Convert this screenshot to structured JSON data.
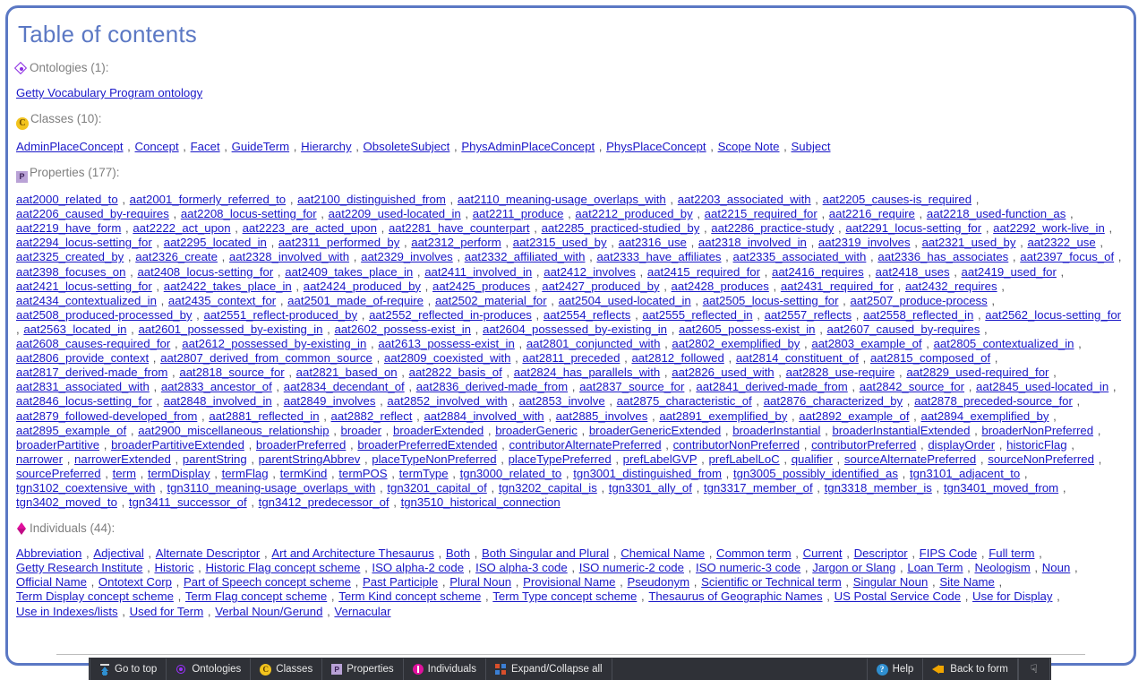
{
  "page": {
    "title": "Table of contents",
    "accent_color": "#5b78c4",
    "link_color": "#1a18c8",
    "section_label_color": "#7f7f7f"
  },
  "sections": [
    {
      "id": "ontologies",
      "icon": "ontology-diamond-icon",
      "label": "Ontologies (1):",
      "count": 1,
      "items": [
        "Getty Vocabulary Program ontology"
      ]
    },
    {
      "id": "classes",
      "icon": "class-circle-c-icon",
      "label": "Classes (10):",
      "count": 10,
      "items": [
        "AdminPlaceConcept",
        "Concept",
        "Facet",
        "GuideTerm",
        "Hierarchy",
        "ObsoleteSubject",
        "PhysAdminPlaceConcept",
        "PhysPlaceConcept",
        "Scope Note",
        "Subject"
      ]
    },
    {
      "id": "properties",
      "icon": "property-square-p-icon",
      "label": "Properties (177):",
      "count": 177,
      "items": [
        "aat2000_related_to",
        "aat2001_formerly_referred_to",
        "aat2100_distinguished_from",
        "aat2110_meaning-usage_overlaps_with",
        "aat2203_associated_with",
        "aat2205_causes-is_required",
        "aat2206_caused_by-requires",
        "aat2208_locus-setting_for",
        "aat2209_used-located_in",
        "aat2211_produce",
        "aat2212_produced_by",
        "aat2215_required_for",
        "aat2216_require",
        "aat2218_used-function_as",
        "aat2219_have_form",
        "aat2222_act_upon",
        "aat2223_are_acted_upon",
        "aat2281_have_counterpart",
        "aat2285_practiced-studied_by",
        "aat2286_practice-study",
        "aat2291_locus-setting_for",
        "aat2292_work-live_in",
        "aat2294_locus-setting_for",
        "aat2295_located_in",
        "aat2311_performed_by",
        "aat2312_perform",
        "aat2315_used_by",
        "aat2316_use",
        "aat2318_involved_in",
        "aat2319_involves",
        "aat2321_used_by",
        "aat2322_use",
        "aat2325_created_by",
        "aat2326_create",
        "aat2328_involved_with",
        "aat2329_involves",
        "aat2332_affiliated_with",
        "aat2333_have_affiliates",
        "aat2335_associated_with",
        "aat2336_has_associates",
        "aat2397_focus_of",
        "aat2398_focuses_on",
        "aat2408_locus-setting_for",
        "aat2409_takes_place_in",
        "aat2411_involved_in",
        "aat2412_involves",
        "aat2415_required_for",
        "aat2416_requires",
        "aat2418_uses",
        "aat2419_used_for",
        "aat2421_locus-setting_for",
        "aat2422_takes_place_in",
        "aat2424_produced_by",
        "aat2425_produces",
        "aat2427_produced_by",
        "aat2428_produces",
        "aat2431_required_for",
        "aat2432_requires",
        "aat2434_contextualized_in",
        "aat2435_context_for",
        "aat2501_made_of-require",
        "aat2502_material_for",
        "aat2504_used-located_in",
        "aat2505_locus-setting_for",
        "aat2507_produce-process",
        "aat2508_produced-processed_by",
        "aat2551_reflect-produced_by",
        "aat2552_reflected_in-produces",
        "aat2554_reflects",
        "aat2555_reflected_in",
        "aat2557_reflects",
        "aat2558_reflected_in",
        "aat2562_locus-setting_for",
        "aat2563_located_in",
        "aat2601_possessed_by-existing_in",
        "aat2602_possess-exist_in",
        "aat2604_possessed_by-existing_in",
        "aat2605_possess-exist_in",
        "aat2607_caused_by-requires",
        "aat2608_causes-required_for",
        "aat2612_possessed_by-existing_in",
        "aat2613_possess-exist_in",
        "aat2801_conjuncted_with",
        "aat2802_exemplified_by",
        "aat2803_example_of",
        "aat2805_contextualized_in",
        "aat2806_provide_context",
        "aat2807_derived_from_common_source",
        "aat2809_coexisted_with",
        "aat2811_preceded",
        "aat2812_followed",
        "aat2814_constituent_of",
        "aat2815_composed_of",
        "aat2817_derived-made_from",
        "aat2818_source_for",
        "aat2821_based_on",
        "aat2822_basis_of",
        "aat2824_has_parallels_with",
        "aat2826_used_with",
        "aat2828_use-require",
        "aat2829_used-required_for",
        "aat2831_associated_with",
        "aat2833_ancestor_of",
        "aat2834_decendant_of",
        "aat2836_derived-made_from",
        "aat2837_source_for",
        "aat2841_derived-made_from",
        "aat2842_source_for",
        "aat2845_used-located_in",
        "aat2846_locus-setting_for",
        "aat2848_involved_in",
        "aat2849_involves",
        "aat2852_involved_with",
        "aat2853_involve",
        "aat2875_characteristic_of",
        "aat2876_characterized_by",
        "aat2878_preceded-source_for",
        "aat2879_followed-developed_from",
        "aat2881_reflected_in",
        "aat2882_reflect",
        "aat2884_involved_with",
        "aat2885_involves",
        "aat2891_exemplified_by",
        "aat2892_example_of",
        "aat2894_exemplified_by",
        "aat2895_example_of",
        "aat2900_miscellaneous_relationship",
        "broader",
        "broaderExtended",
        "broaderGeneric",
        "broaderGenericExtended",
        "broaderInstantial",
        "broaderInstantialExtended",
        "broaderNonPreferred",
        "broaderPartitive",
        "broaderPartitiveExtended",
        "broaderPreferred",
        "broaderPreferredExtended",
        "contributorAlternatePreferred",
        "contributorNonPreferred",
        "contributorPreferred",
        "displayOrder",
        "historicFlag",
        "narrower",
        "narrowerExtended",
        "parentString",
        "parentStringAbbrev",
        "placeTypeNonPreferred",
        "placeTypePreferred",
        "prefLabelGVP",
        "prefLabelLoC",
        "qualifier",
        "sourceAlternatePreferred",
        "sourceNonPreferred",
        "sourcePreferred",
        "term",
        "termDisplay",
        "termFlag",
        "termKind",
        "termPOS",
        "termType",
        "tgn3000_related_to",
        "tgn3001_distinguished_from",
        "tgn3005_possibly_identified_as",
        "tgn3101_adjacent_to",
        "tgn3102_coextensive_with",
        "tgn3110_meaning-usage_overlaps_with",
        "tgn3201_capital_of",
        "tgn3202_capital_is",
        "tgn3301_ally_of",
        "tgn3317_member_of",
        "tgn3318_member_is",
        "tgn3401_moved_from",
        "tgn3402_moved_to",
        "tgn3411_successor_of",
        "tgn3412_predecessor_of",
        "tgn3510_historical_connection"
      ]
    },
    {
      "id": "individuals",
      "icon": "individual-diamond-icon",
      "label": "Individuals (44):",
      "count": 44,
      "items": [
        "Abbreviation",
        "Adjectival",
        "Alternate Descriptor",
        "Art and Architecture Thesaurus",
        "Both",
        "Both Singular and Plural",
        "Chemical Name",
        "Common term",
        "Current",
        "Descriptor",
        "FIPS Code",
        "Full term",
        "Getty Research Institute",
        "Historic",
        "Historic Flag concept scheme",
        "ISO alpha-2 code",
        "ISO alpha-3 code",
        "ISO numeric-2 code",
        "ISO numeric-3 code",
        "Jargon or Slang",
        "Loan Term",
        "Neologism",
        "Noun",
        "Official Name",
        "Ontotext Corp",
        "Part of Speech concept scheme",
        "Past Participle",
        "Plural Noun",
        "Provisional Name",
        "Pseudonym",
        "Scientific or Technical term",
        "Singular Noun",
        "Site Name",
        "Term Display concept scheme",
        "Term Flag concept scheme",
        "Term Kind concept scheme",
        "Term Type concept scheme",
        "Thesaurus of Geographic Names",
        "US Postal Service Code",
        "Use for Display",
        "Use in Indexes/lists",
        "Used for Term",
        "Verbal Noun/Gerund",
        "Vernacular"
      ]
    }
  ],
  "toolbar": {
    "left_buttons": [
      {
        "id": "go-to-top",
        "label": "Go to top",
        "icon": "arrow-up-to-bar-icon"
      },
      {
        "id": "ontologies",
        "label": "Ontologies",
        "icon": "ontology-circle-icon"
      },
      {
        "id": "classes",
        "label": "Classes",
        "icon": "class-circle-c-icon"
      },
      {
        "id": "properties",
        "label": "Properties",
        "icon": "property-square-p-icon"
      },
      {
        "id": "individuals",
        "label": "Individuals",
        "icon": "individual-circle-icon"
      },
      {
        "id": "expand-collapse-all",
        "label": "Expand/Collapse all",
        "icon": "expand-collapse-squares-icon"
      }
    ],
    "right_buttons": [
      {
        "id": "help",
        "label": "Help",
        "icon": "help-question-icon"
      },
      {
        "id": "back-to-form",
        "label": "Back to form",
        "icon": "arrow-left-icon"
      }
    ],
    "more_button": {
      "id": "more",
      "icon": "double-chevron-down-icon",
      "glyph": "»"
    },
    "separator": ","
  }
}
